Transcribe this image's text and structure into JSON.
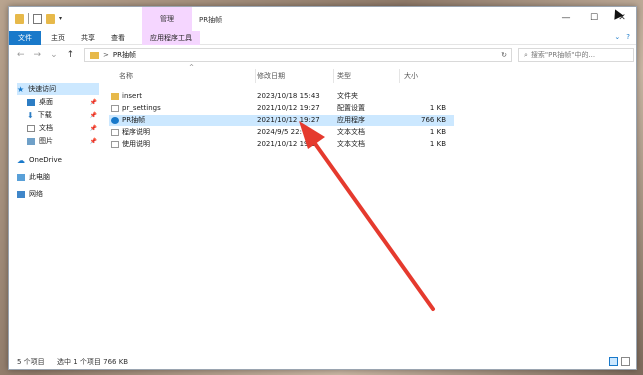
{
  "window": {
    "title": "PR抽帧",
    "manage_tab": "管理",
    "controls": {
      "minimize": "—",
      "maximize": "☐",
      "close": "✕"
    }
  },
  "ribbon": {
    "tabs": [
      {
        "label": "文件"
      },
      {
        "label": "主页"
      },
      {
        "label": "共享"
      },
      {
        "label": "查看"
      },
      {
        "label": "应用程序工具"
      }
    ],
    "right": {
      "collapse": "⌄",
      "help": "?"
    }
  },
  "address": {
    "nav": {
      "back": "←",
      "forward": "→",
      "recent": "⌄",
      "up": "↑"
    },
    "chevron": ">",
    "path": "PR抽帧",
    "refresh": "↻",
    "search_placeholder": "搜索\"PR抽帧\"中的...",
    "search_icon": "⌕"
  },
  "navpane": {
    "items": [
      {
        "label": "快速访问",
        "icon": "star-icon"
      },
      {
        "label": "桌面",
        "icon": "desktop-icon",
        "pinned": true
      },
      {
        "label": "下载",
        "icon": "download-icon",
        "pinned": true
      },
      {
        "label": "文档",
        "icon": "document-icon",
        "pinned": true
      },
      {
        "label": "图片",
        "icon": "picture-icon",
        "pinned": true
      },
      {
        "label": "OneDrive",
        "icon": "cloud-icon"
      },
      {
        "label": "此电脑",
        "icon": "computer-icon"
      },
      {
        "label": "网络",
        "icon": "network-icon"
      }
    ],
    "pin_glyph": "📌"
  },
  "columns": {
    "name": "名称",
    "date": "修改日期",
    "type": "类型",
    "size": "大小",
    "sort_glyph": "^"
  },
  "files": [
    {
      "name": "insert",
      "date": "2023/10/18 15:43",
      "type": "文件夹",
      "size": "",
      "icon": "folder-icon"
    },
    {
      "name": "pr_settings",
      "date": "2021/10/12 19:27",
      "type": "配置设置",
      "size": "1 KB",
      "icon": "settings-file-icon"
    },
    {
      "name": "PR抽帧",
      "date": "2021/10/12 19:27",
      "type": "应用程序",
      "size": "766 KB",
      "icon": "app-icon",
      "selected": true
    },
    {
      "name": "程序说明",
      "date": "2024/9/5 22:",
      "type": "文本文档",
      "size": "1 KB",
      "icon": "text-file-icon"
    },
    {
      "name": "使用说明",
      "date": "2021/10/12 19:2",
      "type": "文本文档",
      "size": "1 KB",
      "icon": "text-file-icon"
    }
  ],
  "status": {
    "count": "5 个项目",
    "selection": "选中 1 个项目 766 KB"
  },
  "colors": {
    "accent": "#1979ca",
    "selection": "#cce8ff",
    "manage_tab": "#f5d6ff",
    "arrow": "#e53a2e"
  }
}
